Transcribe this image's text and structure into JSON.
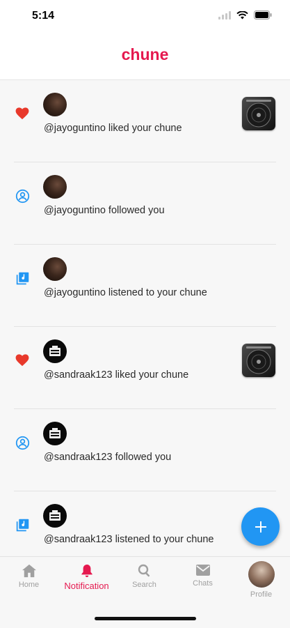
{
  "status_bar": {
    "time": "5:14"
  },
  "header": {
    "title": "chune"
  },
  "colors": {
    "accent": "#e5194f",
    "like": "#e8392b",
    "info": "#2196f3",
    "fab": "#2196f3"
  },
  "notifications": [
    {
      "type": "like",
      "icon": "heart-icon",
      "username": "@jayoguntino",
      "text": "@jayoguntino liked your chune",
      "has_thumbnail": true
    },
    {
      "type": "follow",
      "icon": "user-circle-icon",
      "username": "@jayoguntino",
      "text": "@jayoguntino followed you",
      "has_thumbnail": false
    },
    {
      "type": "listen",
      "icon": "music-library-icon",
      "username": "@jayoguntino",
      "text": "@jayoguntino listened to your chune",
      "has_thumbnail": false
    },
    {
      "type": "like",
      "icon": "heart-icon",
      "username": "@sandraak123",
      "text": "@sandraak123 liked your chune",
      "has_thumbnail": true
    },
    {
      "type": "follow",
      "icon": "user-circle-icon",
      "username": "@sandraak123",
      "text": "@sandraak123 followed you",
      "has_thumbnail": false
    },
    {
      "type": "listen",
      "icon": "music-library-icon",
      "username": "@sandraak123",
      "text": "@sandraak123 listened to your chune",
      "has_thumbnail": false
    }
  ],
  "fab": {
    "icon": "plus-icon"
  },
  "nav": {
    "home": "Home",
    "notification": "Notification",
    "search": "Search",
    "chats": "Chats",
    "profile": "Profile",
    "active": "Notification"
  }
}
